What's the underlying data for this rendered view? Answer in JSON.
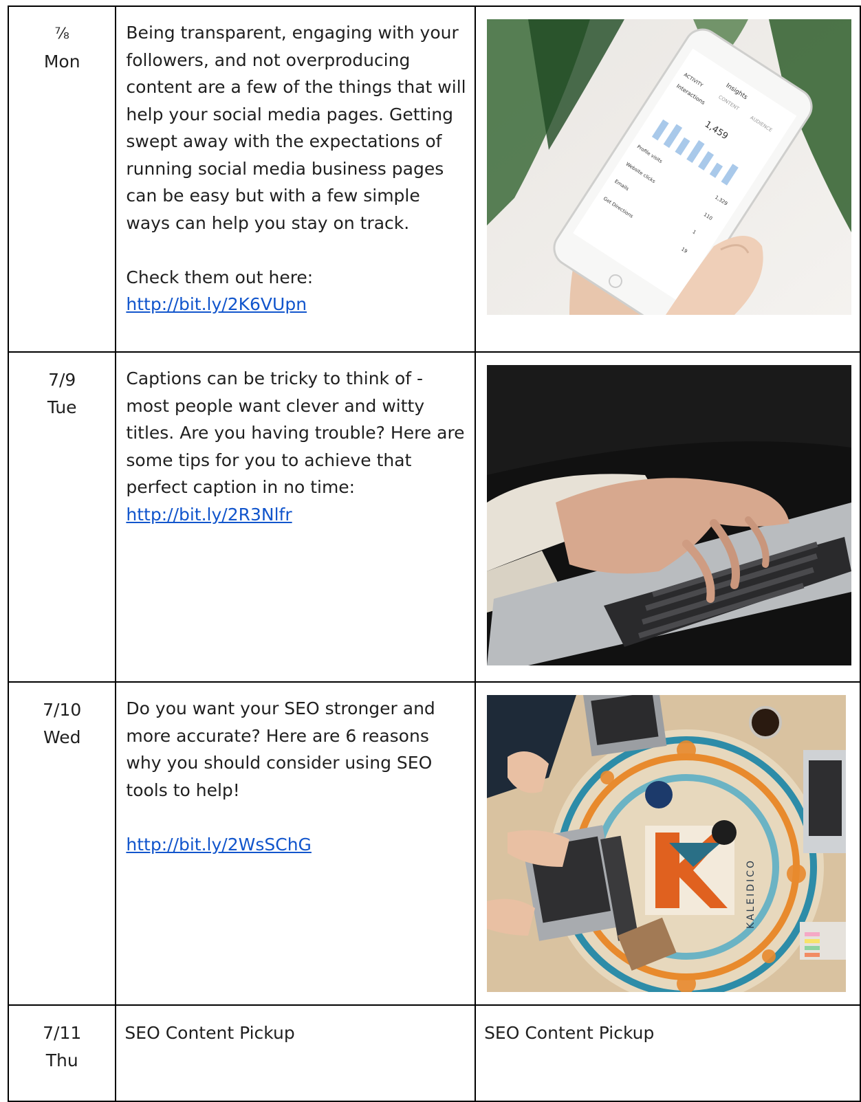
{
  "rows": [
    {
      "date": "⅞",
      "day": "Mon",
      "paragraphs": [
        "Being transparent, engaging with your followers, and not overproducing content are a few of the things that will help your social media pages. Getting swept away with the expectations of running social media business pages can be easy but with a few simple ways can help you stay on track.",
        "Check them out here:"
      ],
      "link": "http://bit.ly/2K6VUpn",
      "image_icon": "phone-insights-photo",
      "phone_screen": {
        "title": "Insights",
        "tabs": [
          "ACTIVITY",
          "CONTENT",
          "AUDIENCE"
        ],
        "section": "Interactions",
        "total": "1,459",
        "metrics": [
          "Profile visits",
          "Website clicks",
          "Emails",
          "Get Directions"
        ],
        "metric_values": [
          "1,329",
          "110",
          "1",
          "19"
        ]
      }
    },
    {
      "date": "7/9",
      "day": "Tue",
      "paragraphs": [
        "Captions can be tricky to think of - most people want clever and witty titles. Are you having trouble? Here are some tips for you to achieve that perfect caption in no time:"
      ],
      "link": "http://bit.ly/2R3Nlfr",
      "image_icon": "laptop-typing-photo"
    },
    {
      "date": "7/10",
      "day": "Wed",
      "paragraphs": [
        "Do you want your SEO stronger and more accurate? Here are 6 reasons why you should consider using SEO tools to help!"
      ],
      "link": "http://bit.ly/2WsSChG",
      "image_icon": "kaleidico-desk-photo",
      "mat_label": "KALEIDICO"
    },
    {
      "date": "7/11",
      "day": "Thu",
      "text": "SEO Content Pickup",
      "image_text": "SEO Content Pickup"
    }
  ],
  "colors": {
    "link": "#1155cc",
    "border": "#000000"
  }
}
